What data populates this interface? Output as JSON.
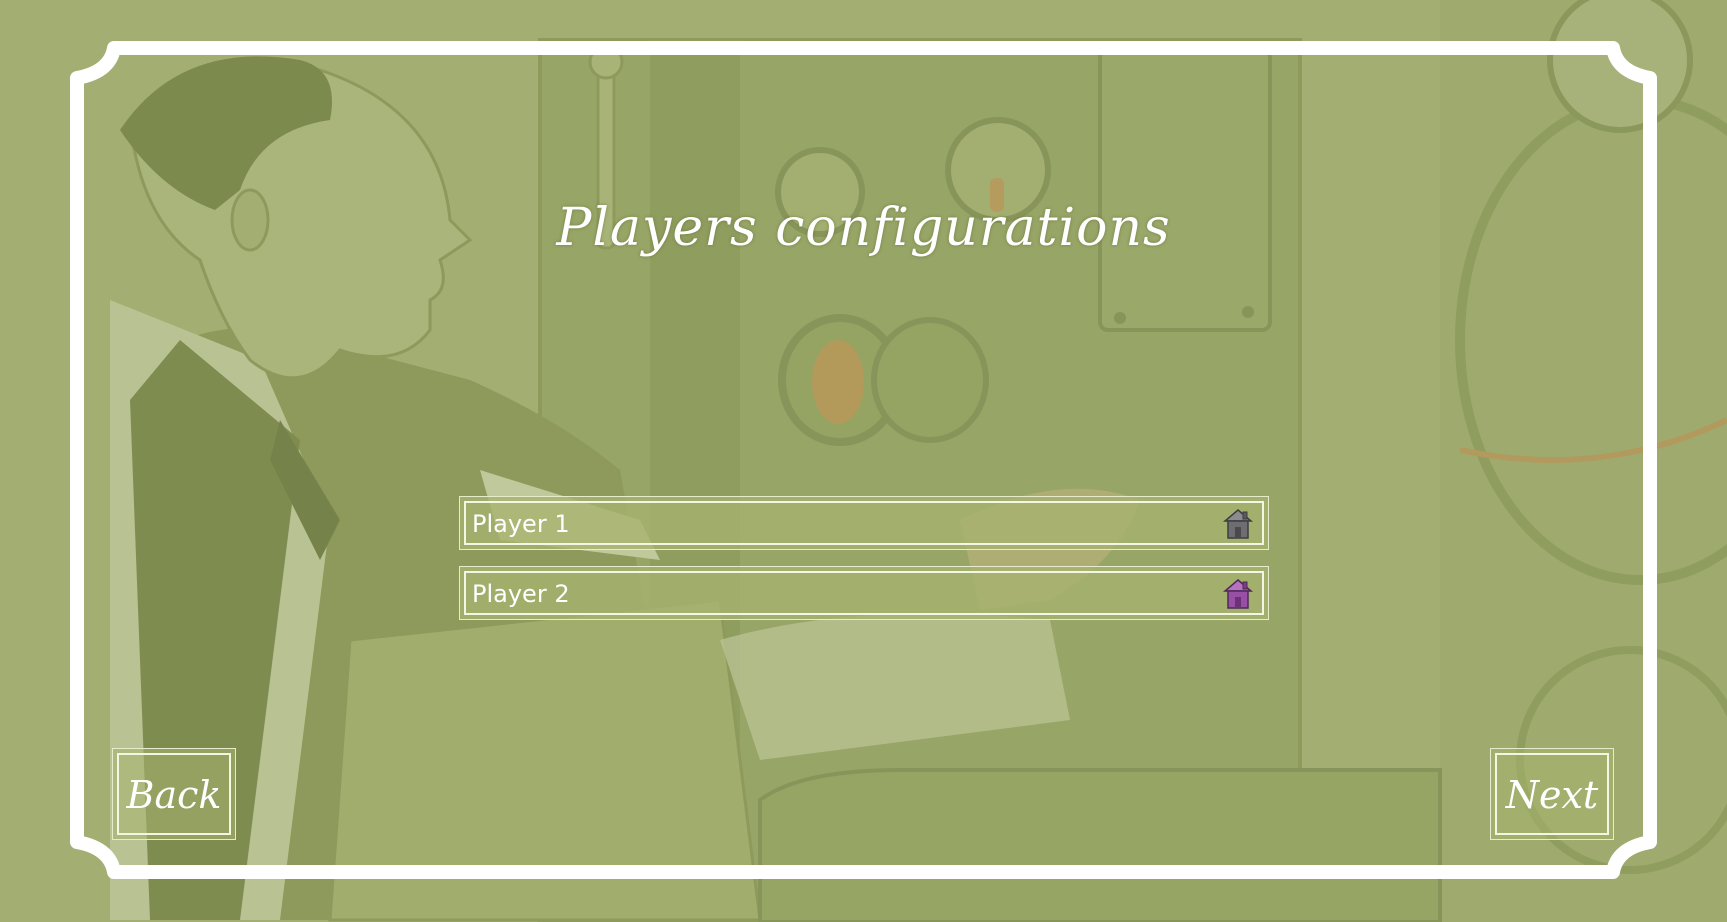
{
  "screen": {
    "title": "Players configurations"
  },
  "players": [
    {
      "name": "Player 1",
      "icon": "house-icon",
      "color": "#6e6e72"
    },
    {
      "name": "Player 2",
      "icon": "house-icon",
      "color": "#9a4fa6"
    }
  ],
  "navigation": {
    "back_label": "Back",
    "next_label": "Next"
  },
  "colors": {
    "background": "#a3ae72",
    "frame": "#ffffff"
  }
}
